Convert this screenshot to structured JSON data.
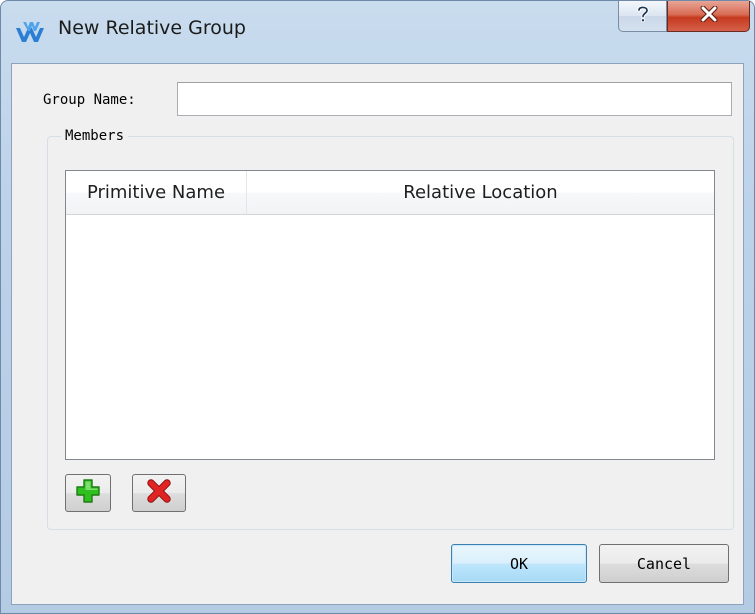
{
  "window": {
    "title": "New Relative Group",
    "app_icon": "wave-logo-icon",
    "help_icon": "question-mark-icon",
    "close_icon": "close-x-icon"
  },
  "form": {
    "group_name_label": "Group Name:",
    "group_name_value": "",
    "members_legend": "Members"
  },
  "members_table": {
    "columns": [
      "Primitive Name",
      "Relative Location"
    ],
    "rows": []
  },
  "member_actions": {
    "add_icon": "plus-icon",
    "delete_icon": "delete-x-icon"
  },
  "buttons": {
    "ok_label": "OK",
    "cancel_label": "Cancel"
  },
  "colors": {
    "add_icon": "#2fbf1f",
    "delete_icon": "#d81818",
    "close_button": "#c8452c",
    "app_icon": "#2a7fd4"
  }
}
